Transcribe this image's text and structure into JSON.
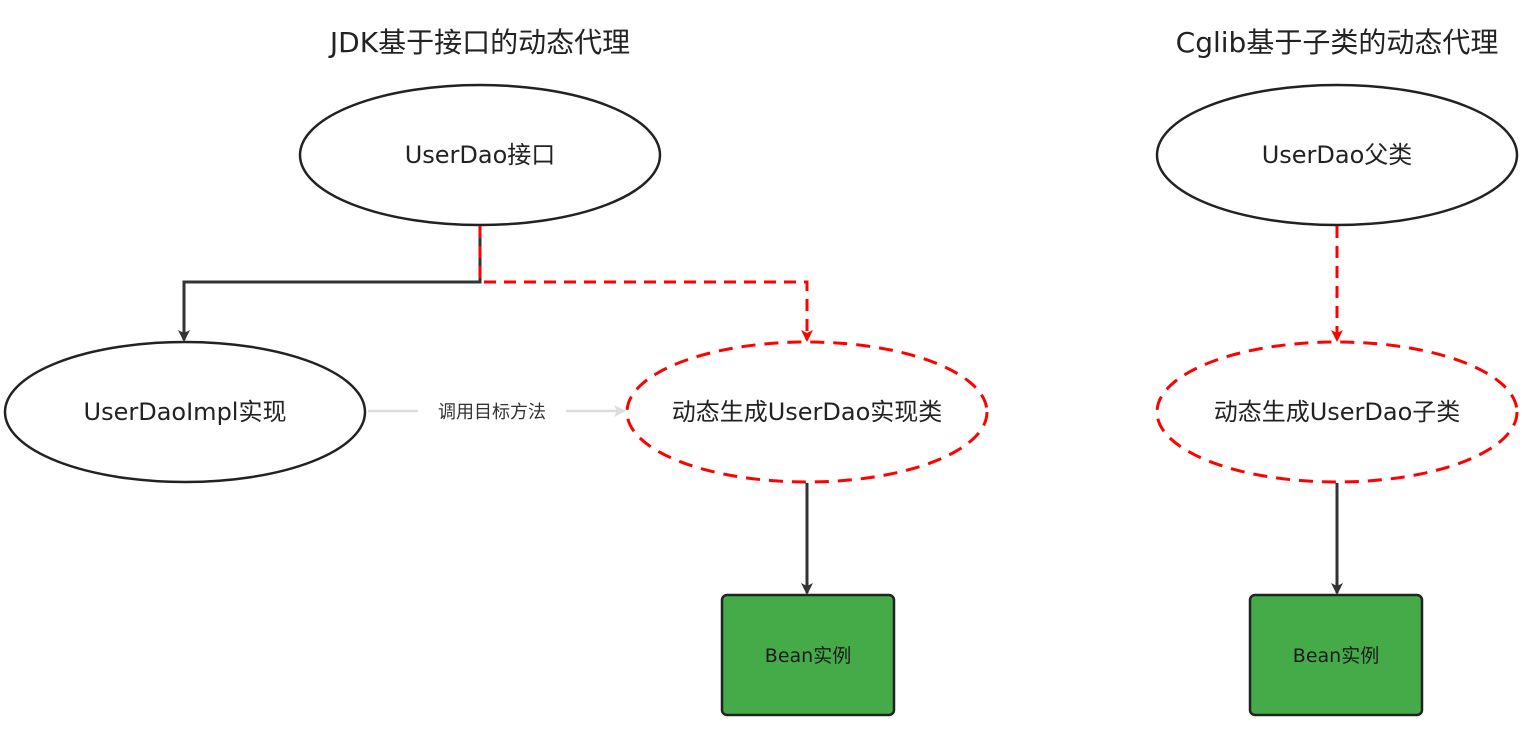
{
  "jdk": {
    "title": "JDK基于接口的动态代理",
    "interface_node": "UserDao接口",
    "impl_node": "UserDaoImpl实现",
    "proxy_node": "动态生成UserDao实现类",
    "call_label": "调用目标方法",
    "bean_node": "Bean实例"
  },
  "cglib": {
    "title": "Cglib基于子类的动态代理",
    "parent_node": "UserDao父类",
    "proxy_node": "动态生成UserDao子类",
    "bean_node": "Bean实例"
  },
  "colors": {
    "proxy_red": "#ff0000",
    "bean_green": "#45ab49",
    "bean_border": "#222222",
    "solid_arrow": "#333333",
    "call_arrow": "#dddddd"
  }
}
